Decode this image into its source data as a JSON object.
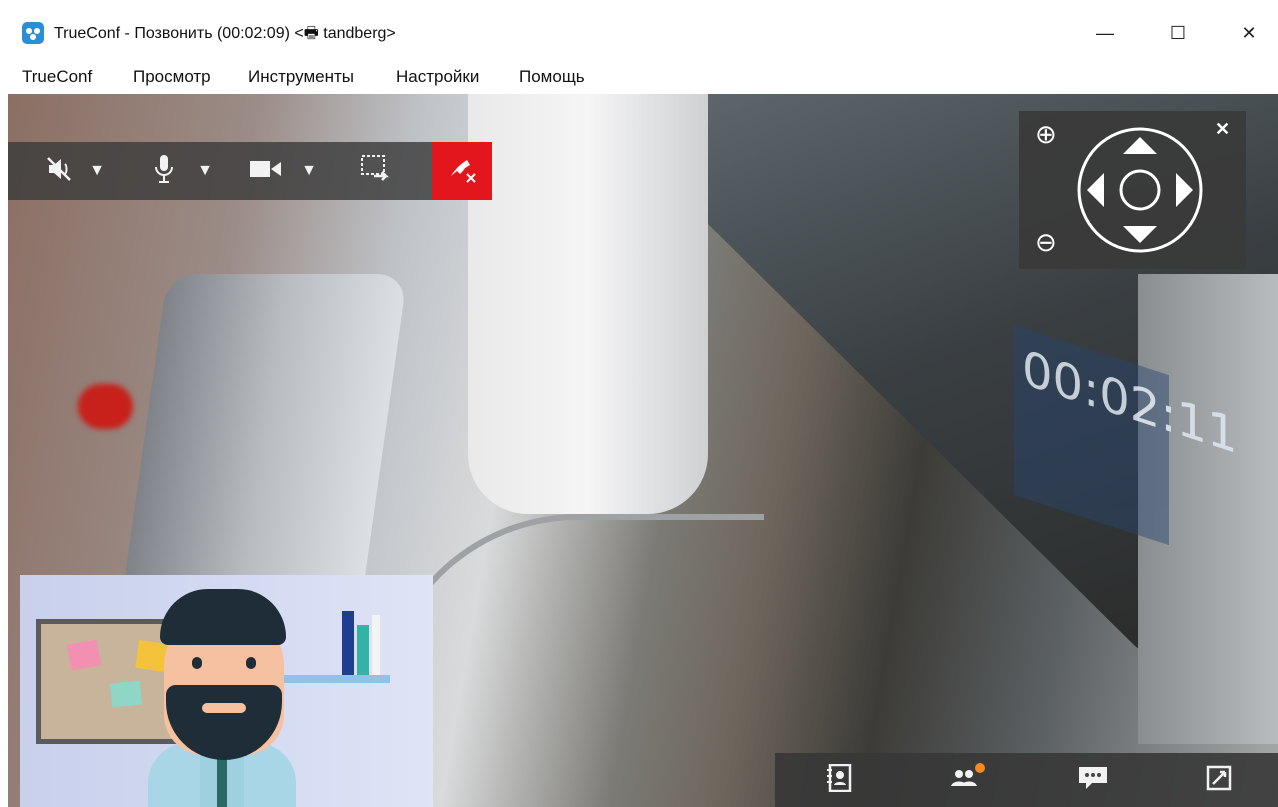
{
  "window": {
    "title": "TrueConf - Позвонить (00:02:09) <🖶 tandberg>",
    "minimize": "—",
    "maximize": "☐",
    "close": "✕"
  },
  "menu": [
    "TrueConf",
    "Просмотр",
    "Инструменты",
    "Настройки",
    "Помощь"
  ],
  "video": {
    "timestamp_overlay": "00:02:11"
  },
  "toolbar": {
    "icons": [
      "speaker-mute-icon",
      "microphone-icon",
      "camera-icon",
      "share-screen-icon",
      "hangup-icon"
    ],
    "dropdown_glyph": "▼",
    "hangup_color": "#e3161d"
  },
  "ptz": {
    "close_glyph": "✕",
    "zoom_in_glyph": "⊕",
    "zoom_out_glyph": "⊖"
  },
  "bottombar": {
    "icons": [
      "contacts-icon",
      "participants-icon",
      "chat-icon",
      "fullscreen-icon"
    ],
    "participants_badge_color": "#f58a1f"
  }
}
